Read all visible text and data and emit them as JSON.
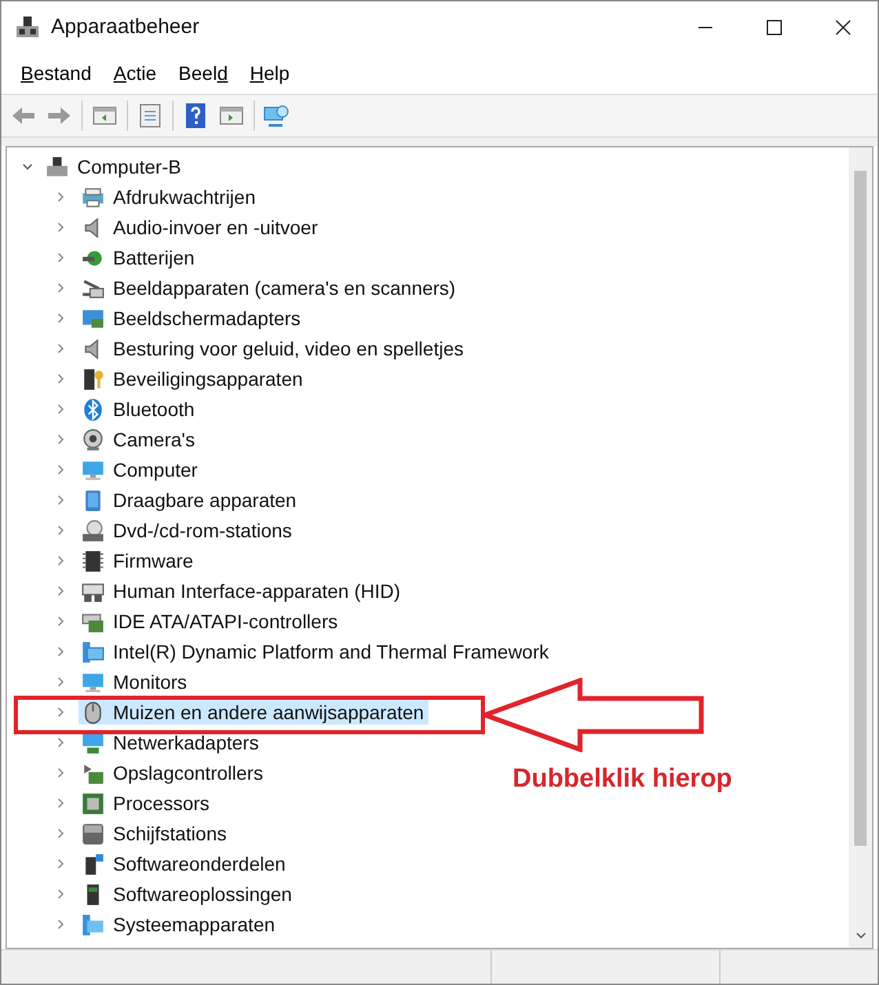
{
  "window": {
    "title": "Apparaatbeheer"
  },
  "menu": [
    {
      "key": "B",
      "after": "estand"
    },
    {
      "key": "A",
      "after": "ctie"
    },
    {
      "before": "Beel",
      "key": "d"
    },
    {
      "key": "H",
      "after": "elp"
    }
  ],
  "tree": {
    "label": "Computer-B",
    "expanded": true,
    "children": [
      {
        "label": "Afdrukwachtrijen",
        "expanded": false,
        "selected": false
      },
      {
        "label": "Audio-invoer en -uitvoer",
        "expanded": false,
        "selected": false
      },
      {
        "label": "Batterijen",
        "expanded": false,
        "selected": false
      },
      {
        "label": "Beeldapparaten (camera's en scanners)",
        "expanded": false,
        "selected": false
      },
      {
        "label": "Beeldschermadapters",
        "expanded": false,
        "selected": false
      },
      {
        "label": "Besturing voor geluid, video en spelletjes",
        "expanded": false,
        "selected": false
      },
      {
        "label": "Beveiligingsapparaten",
        "expanded": false,
        "selected": false
      },
      {
        "label": "Bluetooth",
        "expanded": false,
        "selected": false
      },
      {
        "label": "Camera's",
        "expanded": false,
        "selected": false
      },
      {
        "label": "Computer",
        "expanded": false,
        "selected": false
      },
      {
        "label": "Draagbare apparaten",
        "expanded": false,
        "selected": false
      },
      {
        "label": "Dvd-/cd-rom-stations",
        "expanded": false,
        "selected": false
      },
      {
        "label": "Firmware",
        "expanded": false,
        "selected": false
      },
      {
        "label": "Human Interface-apparaten (HID)",
        "expanded": false,
        "selected": false
      },
      {
        "label": "IDE ATA/ATAPI-controllers",
        "expanded": false,
        "selected": false
      },
      {
        "label": "Intel(R) Dynamic Platform and Thermal Framework",
        "expanded": false,
        "selected": false
      },
      {
        "label": "Monitors",
        "expanded": false,
        "selected": false
      },
      {
        "label": "Muizen en andere aanwijsapparaten",
        "expanded": false,
        "selected": true
      },
      {
        "label": "Netwerkadapters",
        "expanded": false,
        "selected": false
      },
      {
        "label": "Opslagcontrollers",
        "expanded": false,
        "selected": false
      },
      {
        "label": "Processors",
        "expanded": false,
        "selected": false
      },
      {
        "label": "Schijfstations",
        "expanded": false,
        "selected": false
      },
      {
        "label": "Softwareonderdelen",
        "expanded": false,
        "selected": false
      },
      {
        "label": "Softwareoplossingen",
        "expanded": false,
        "selected": false
      },
      {
        "label": "Systeemapparaten",
        "expanded": false,
        "selected": false
      }
    ]
  },
  "annotation": {
    "text": "Dubbelklik hierop"
  }
}
